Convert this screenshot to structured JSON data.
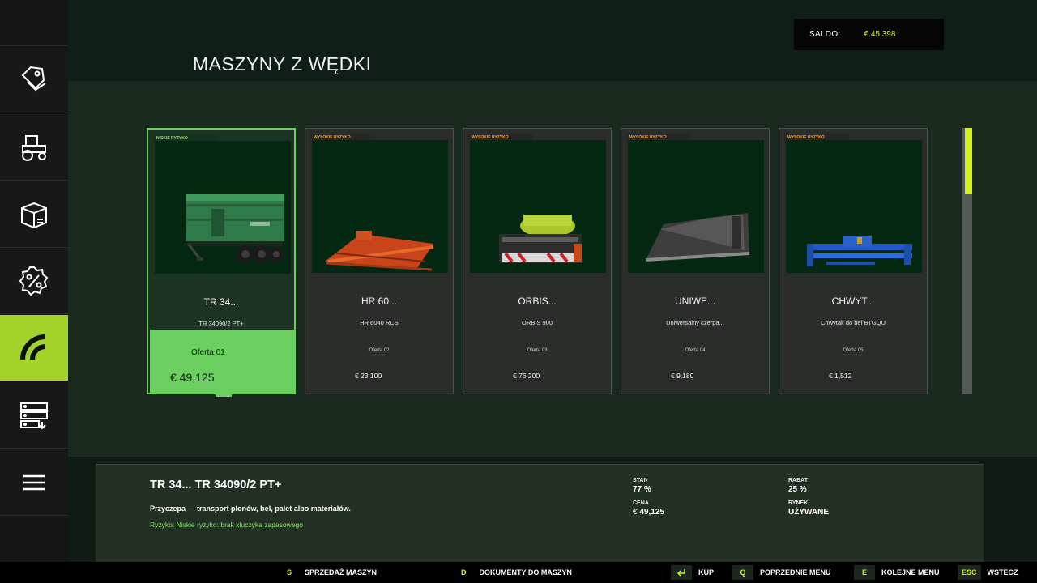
{
  "header": {
    "title": "MASZYNY Z WĘDKI",
    "balance_label": "SALDO:",
    "balance_value": "€ 45,398"
  },
  "sidebar": {
    "items": [
      {
        "icon": "price-tag-icon",
        "active": false
      },
      {
        "icon": "tractor-icon",
        "active": false
      },
      {
        "icon": "box-icon",
        "active": false
      },
      {
        "icon": "percent-badge-icon",
        "active": false
      },
      {
        "icon": "gauge-icon",
        "active": true
      },
      {
        "icon": "server-transfer-icon",
        "active": false
      },
      {
        "icon": "menu-lines-icon",
        "active": false
      }
    ]
  },
  "cards": [
    {
      "risk": "NISKIE RYZYKO",
      "name": "TR 34...",
      "subtitle": "TR 34090/2 PT+",
      "offer": "Oferta 01",
      "price": "€ 49,125",
      "image": "green-trailer",
      "selected": true
    },
    {
      "risk": "WYSOKIE RYZYKO",
      "name": "HR 60...",
      "subtitle": "HR 6040 RCS",
      "offer": "Oferta 02",
      "price": "€ 23,100",
      "image": "red-harrow",
      "selected": false
    },
    {
      "risk": "WYSOKIE RYZYKO",
      "name": "ORBIS...",
      "subtitle": "ORBIS 900",
      "offer": "Oferta 03",
      "price": "€ 76,200",
      "image": "orbis-header",
      "selected": false
    },
    {
      "risk": "WYSOKIE RYZYKO",
      "name": "UNIWE...",
      "subtitle": "Uniwersalny czerpa...",
      "offer": "Oferta 04",
      "price": "€ 9,180",
      "image": "bucket",
      "selected": false
    },
    {
      "risk": "WYSOKIE RYZYKO",
      "name": "CHWYT...",
      "subtitle": "Chwytak do bel BTGQU",
      "offer": "Oferta 05",
      "price": "€ 1,512",
      "image": "bale-grab",
      "selected": false
    }
  ],
  "scroll": {
    "position": 0.0,
    "visible_fraction": 0.25
  },
  "detail": {
    "title": "TR 34... TR 34090/2 PT+",
    "description": "Przyczepa — transport plonów, bel, palet albo materiałów.",
    "risk_line": "Ryzyko: Niskie ryzyko: brak kluczyka zapasowego",
    "stan_label": "STAN",
    "stan_value": "77 %",
    "cena_label": "CENA",
    "cena_value": "€ 49,125",
    "rabat_label": "RABAT",
    "rabat_value": "25 %",
    "rynek_label": "RYNEK",
    "rynek_value": "UŻYWANE"
  },
  "bottom_bar": {
    "sell_key": "S",
    "sell_label": "SPRZEDAŻ MASZYN",
    "docs_key": "D",
    "docs_label": "DOKUMENTY DO MASZYN",
    "buy_key_icon": "enter-key-icon",
    "buy_label": "KUP",
    "prev_key": "Q",
    "prev_label": "POPRZEDNIE MENU",
    "next_key": "E",
    "next_label": "KOLEJNE MENU",
    "back_key": "ESC",
    "back_label": "WSTECZ"
  },
  "colors": {
    "accent": "#a3d32b",
    "selected": "#6bcf5f",
    "high_risk": "#ffa02a",
    "low_risk": "#87e06e",
    "balance": "#c9ef2f"
  }
}
